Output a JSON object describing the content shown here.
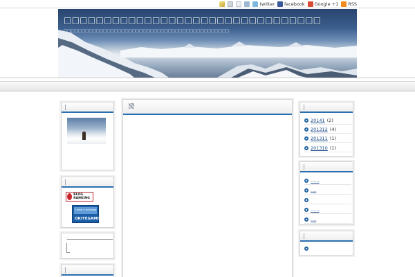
{
  "topbar": {
    "items": [
      {
        "icon": "pencil-icon",
        "label": ""
      },
      {
        "icon": "user-icon",
        "label": ""
      },
      {
        "icon": "mail-icon",
        "label": ""
      },
      {
        "icon": "share-icon",
        "label": ""
      },
      {
        "icon": "twitter-icon",
        "label": "twitter"
      },
      {
        "icon": "facebook-icon",
        "label": "facebook"
      },
      {
        "icon": "google-plus-icon",
        "label": "Google +1"
      },
      {
        "icon": "rss-icon",
        "label": "RSS"
      }
    ]
  },
  "header": {
    "title": "□□□□□□□□□□□□□□□□□□□□□□□□□□□□□□□□",
    "subtitle": "□□□□□□□□□□□□□□□□□□□□□□□□□□□□□□□□□□□□□□□□□□□□□□"
  },
  "archive": {
    "items": [
      {
        "label": "20141",
        "count": "(2)"
      },
      {
        "label": "201312",
        "count": "(4)"
      },
      {
        "label": "201311",
        "count": "(1)"
      },
      {
        "label": "201310",
        "count": "(1)"
      }
    ]
  },
  "recent": {
    "items": [
      {
        "label": "......"
      },
      {
        "label": "...."
      },
      {
        "label": ""
      },
      {
        "label": "......"
      },
      {
        "label": "...."
      }
    ]
  },
  "badges": {
    "blog_ranking": "BLOG RANKING",
    "okitegami_small": "Leave a message",
    "okitegami": "OKITEGAMI"
  },
  "colors": {
    "accent": "#2a6fb0",
    "link": "#1f4d8c"
  }
}
